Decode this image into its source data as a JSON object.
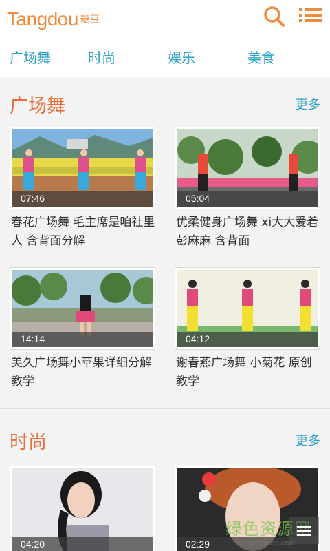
{
  "header": {
    "logo_text": "Tangdou",
    "logo_sub": "糖豆",
    "brand_color": "#f08a3c",
    "search_icon": "search-icon",
    "menu_icon": "menu-icon"
  },
  "tabs": [
    {
      "label": "广场舞"
    },
    {
      "label": "时尚"
    },
    {
      "label": "娱乐"
    },
    {
      "label": "美食"
    }
  ],
  "accent_color": "#2aa0c8",
  "sections": [
    {
      "title": "广场舞",
      "more": "更多",
      "videos": [
        {
          "duration": "07:46",
          "title": "春花广场舞 毛主席是咱社里人 含背面分解"
        },
        {
          "duration": "05:04",
          "title": "优柔健身广场舞 xi大大爱着彭麻麻 含背面"
        },
        {
          "duration": "14:14",
          "title": "美久广场舞小苹果详细分解教学"
        },
        {
          "duration": "04:12",
          "title": "谢春燕广场舞 小菊花 原创教学"
        }
      ]
    },
    {
      "title": "时尚",
      "more": "更多",
      "videos": [
        {
          "duration": "04:20",
          "title": ""
        },
        {
          "duration": "02:29",
          "title": ""
        }
      ]
    }
  ],
  "watermark": {
    "text": "绿色资源网",
    "url": "www.downcc.com"
  }
}
